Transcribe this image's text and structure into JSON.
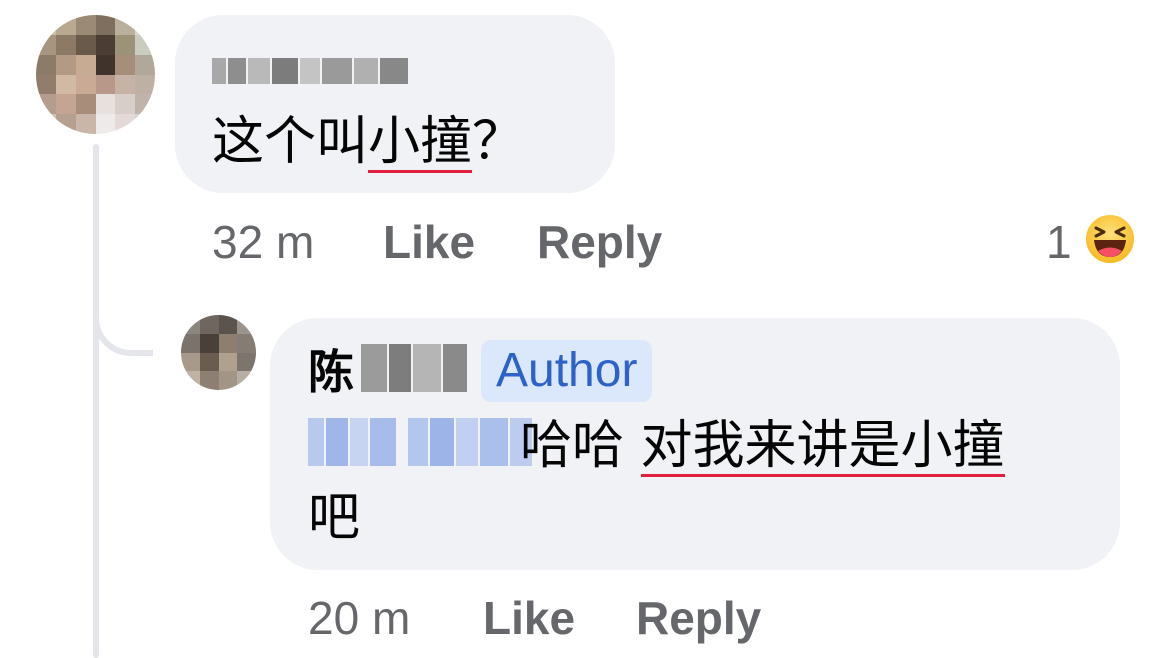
{
  "comments": [
    {
      "text": "这个叫",
      "underlined_text": "小撞",
      "trailing_text": "？",
      "time": "32 m",
      "like_label": "Like",
      "reply_label": "Reply",
      "reaction_count": "1",
      "reaction_icon": "haha-emoji-icon"
    },
    {
      "author_name_visible": "陈",
      "author_badge": "Author",
      "text_line1_plain": "哈哈 ",
      "text_line1_underlined": "对我来讲是小撞",
      "text_line2": "吧",
      "time": "20 m",
      "like_label": "Like",
      "reply_label": "Reply"
    }
  ],
  "colors": {
    "bubble_bg": "#f0f2f5",
    "meta_text": "#65676b",
    "badge_bg": "#dbe7fb",
    "badge_text": "#2d63c8",
    "underline": "#e41e3f",
    "thread_line": "#e4e6eb"
  }
}
